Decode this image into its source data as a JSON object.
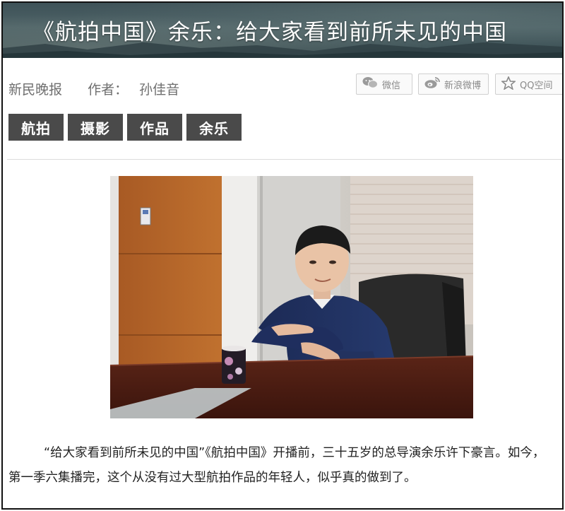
{
  "article": {
    "title": "《航拍中国》余乐：给大家看到前所未见的中国",
    "source": "新民晚报",
    "author_label": "作者：",
    "author": "孙佳音"
  },
  "share": {
    "wechat": "微信",
    "weibo": "新浪微博",
    "qzone": "QQ空间",
    "icons": [
      "wechat-icon",
      "weibo-icon",
      "qzone-star-icon"
    ]
  },
  "tags": [
    "航拍",
    "摄影",
    "作品",
    "余乐"
  ],
  "body": {
    "line1": "“给大家看到前所未见的中国”《航拍中国》开播前，三十五岁的总导演余乐许下豪言。如今，",
    "line2": "第一季六集播完，这个从没有过大型航拍作品的年轻人，似乎真的做到了。"
  },
  "colors": {
    "tag_bg": "#4a4a4a",
    "banner": "#4d6266",
    "sweater": "#1f2d57",
    "desk": "#4a1e14"
  }
}
